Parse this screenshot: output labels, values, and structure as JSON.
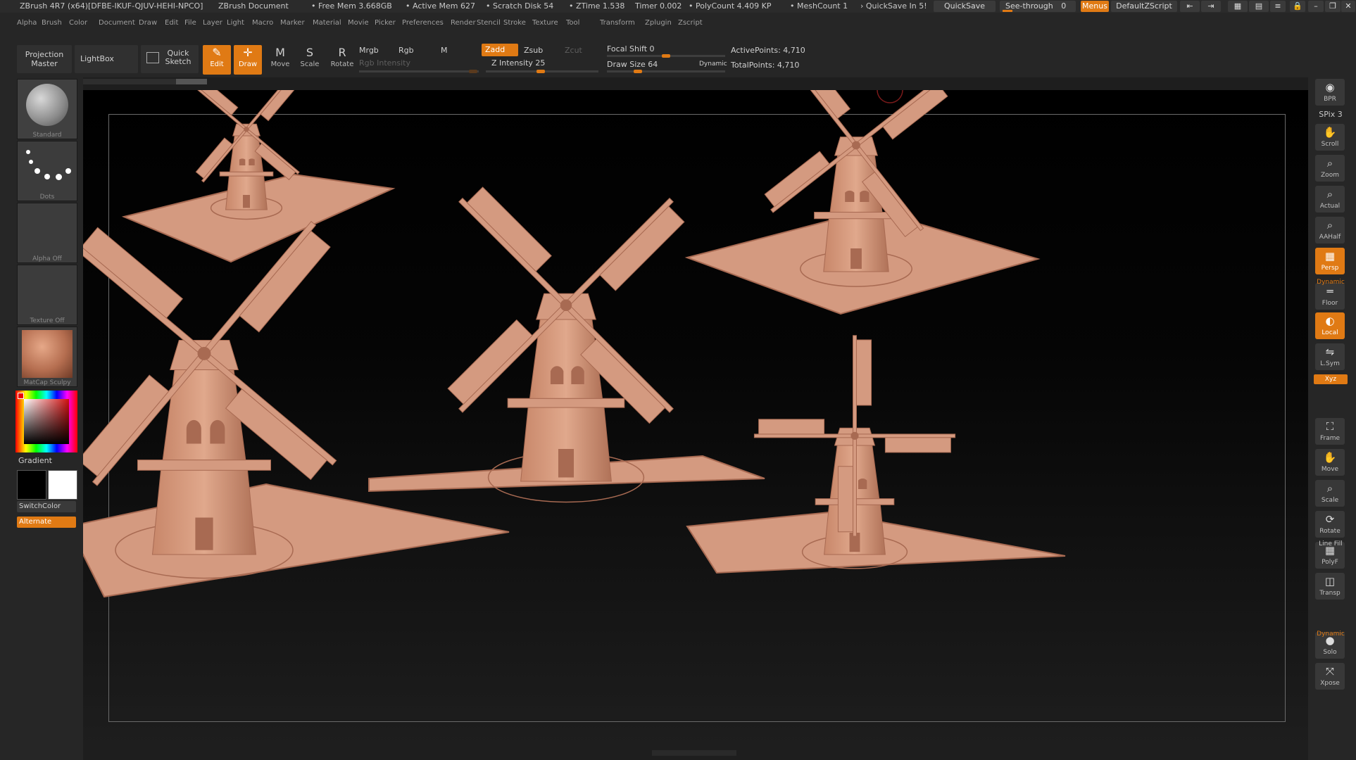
{
  "titlebar": {
    "app": "ZBrush 4R7 (x64)[DFBE-IKUF-QJUV-HEHI-NPCO]",
    "document": "ZBrush Document",
    "free_mem": "• Free Mem 3.668GB",
    "active_mem": "• Active Mem 627",
    "scratch": "• Scratch Disk 54",
    "ztime": "• ZTime 1.538",
    "timer": "Timer 0.002",
    "polycount": "• PolyCount 4.409 KP",
    "meshcount": "• MeshCount 1",
    "quicksave_info": "› QuickSave In 5!",
    "quicksave_btn": "QuickSave",
    "seethrough_label": "See-through",
    "seethrough_value": "0",
    "menus_btn": "Menus",
    "script_btn": "DefaultZScript"
  },
  "menubar": [
    "Alpha",
    "Brush",
    "Color",
    "Document",
    "Draw",
    "Edit",
    "File",
    "Layer",
    "Light",
    "Macro",
    "Marker",
    "Material",
    "Movie",
    "Picker",
    "Preferences",
    "Render",
    "Stencil",
    "Stroke",
    "Texture",
    "Tool",
    "Transform",
    "Zplugin",
    "Zscript"
  ],
  "toolbar": {
    "projection_master": "Projection Master",
    "lightbox": "LightBox",
    "quick_sketch": "Quick Sketch",
    "tools": [
      {
        "label": "Edit",
        "icon": "edit-icon",
        "glyph": "✎",
        "on": true
      },
      {
        "label": "Draw",
        "icon": "draw-icon",
        "glyph": "✛",
        "on": true
      },
      {
        "label": "Move",
        "icon": "move-icon",
        "glyph": "M",
        "on": false
      },
      {
        "label": "Scale",
        "icon": "scale-icon",
        "glyph": "S",
        "on": false
      },
      {
        "label": "Rotate",
        "icon": "rotate-icon",
        "glyph": "R",
        "on": false
      }
    ],
    "mrgb": "Mrgb",
    "rgb": "Rgb",
    "m": "M",
    "rgb_intensity": "Rgb Intensity",
    "zadd": "Zadd",
    "zsub": "Zsub",
    "zcut": "Zcut",
    "z_intensity": "Z Intensity 25",
    "focal_shift": "Focal Shift 0",
    "draw_size": "Draw Size 64",
    "dynamic": "Dynamic",
    "active_points": "ActivePoints: 4,710",
    "total_points": "TotalPoints: 4,710"
  },
  "left_shelf": {
    "brush": "Standard",
    "stroke": "Dots",
    "alpha": "Alpha Off",
    "texture": "Texture Off",
    "material": "MatCap Sculpy",
    "gradient": "Gradient",
    "switchcolor": "SwitchColor",
    "alternate": "Alternate"
  },
  "right_shelf": [
    {
      "label": "BPR",
      "icon": "bpr-icon",
      "glyph": "◉",
      "on": false
    },
    {
      "label": "Scroll",
      "icon": "scroll-icon",
      "glyph": "✋",
      "on": false
    },
    {
      "label": "Zoom",
      "icon": "zoom-icon",
      "glyph": "⌕",
      "on": false
    },
    {
      "label": "Actual",
      "icon": "actual-icon",
      "glyph": "⌕",
      "on": false
    },
    {
      "label": "AAHalf",
      "icon": "aahalf-icon",
      "glyph": "⌕",
      "on": false
    },
    {
      "label": "Persp",
      "icon": "persp-icon",
      "glyph": "▦",
      "on": true
    },
    {
      "label": "Floor",
      "icon": "floor-icon",
      "glyph": "═",
      "on": false
    },
    {
      "label": "Local",
      "icon": "local-icon",
      "glyph": "◐",
      "on": true
    },
    {
      "label": "L.Sym",
      "icon": "lsym-icon",
      "glyph": "⇋",
      "on": false
    },
    {
      "label": "Frame",
      "icon": "frame-icon",
      "glyph": "⛶",
      "on": false
    },
    {
      "label": "Move",
      "icon": "move-view-icon",
      "glyph": "✋",
      "on": false
    },
    {
      "label": "Scale",
      "icon": "scale-view-icon",
      "glyph": "⌕",
      "on": false
    },
    {
      "label": "Rotate",
      "icon": "rotate-view-icon",
      "glyph": "⟳",
      "on": false
    },
    {
      "label": "PolyF",
      "icon": "polyf-icon",
      "glyph": "▦",
      "on": false
    },
    {
      "label": "Transp",
      "icon": "transp-icon",
      "glyph": "◫",
      "on": false
    },
    {
      "label": "Solo",
      "icon": "solo-icon",
      "glyph": "●",
      "on": false
    },
    {
      "label": "Xpose",
      "icon": "xpose-icon",
      "glyph": "⤧",
      "on": false
    }
  ],
  "right_extra": {
    "spix": "SPix 3",
    "dynamic_top": "Dynamic",
    "xyz": "Xyz",
    "line_fill": "Line Fill",
    "dynamic_bottom": "Dynamic"
  },
  "colors": {
    "accent": "#e07a14",
    "clay": "#d49a80",
    "clay_dark": "#a86a52"
  }
}
